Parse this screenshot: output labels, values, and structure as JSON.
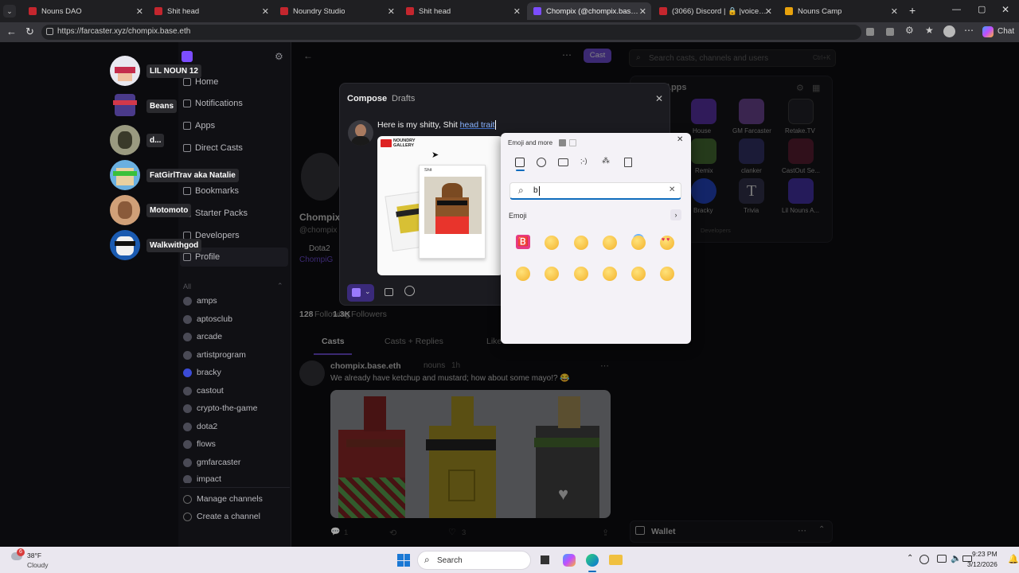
{
  "browser": {
    "tabs": [
      {
        "title": "Nouns DAO",
        "fav": "#c4262e"
      },
      {
        "title": "Shit head",
        "fav": "#c4262e"
      },
      {
        "title": "Noundry Studio",
        "fav": "#c4262e"
      },
      {
        "title": "Shit head",
        "fav": "#c4262e"
      },
      {
        "title": "Chompix (@chompix.base.eth) on",
        "fav": "#7c4dff",
        "active": true
      },
      {
        "title": "(3066) Discord | 🔒 |voice-public",
        "fav": "#c4262e"
      },
      {
        "title": "Nouns Camp",
        "fav": "#e8a20c"
      }
    ],
    "url": "https://farcaster.xyz/chompix.base.eth",
    "chat_label": "Chat"
  },
  "overlay_users": [
    "LIL NOUN 12",
    "Beans",
    "d...",
    "FatGirlTrav aka Natalie",
    "Motomoto",
    "Walkwithgod"
  ],
  "nav": {
    "items": [
      "Home",
      "Notifications",
      "Apps",
      "Direct Casts",
      "Bookmarks",
      "Starter Packs",
      "Developers",
      "Profile"
    ],
    "section_label": "All",
    "channels": [
      "amps",
      "aptosclub",
      "arcade",
      "artistprogram",
      "bracky",
      "castout",
      "crypto-the-game",
      "dota2",
      "flows",
      "gmfarcaster",
      "impact"
    ],
    "manage": "Manage channels",
    "create": "Create a channel"
  },
  "header": {
    "cast_button": "Cast",
    "search_placeholder": "Search casts, channels and users",
    "search_shortcut": "Ctrl+K"
  },
  "profile": {
    "name": "Chompix",
    "handle": "@chompix",
    "bio": "Dota2",
    "link": "ChompiG",
    "following_count": "128",
    "following_label": "Following",
    "followers_count": "1.3K",
    "followers_label": "Followers",
    "tabs": [
      "Casts",
      "Casts + Replies",
      "Likes"
    ]
  },
  "cast": {
    "author": "chompix.base.eth",
    "channel": "nouns",
    "time": "1h",
    "text": "We already have ketchup and mustard; how about some mayo!? 😂",
    "reply_count": "1",
    "like_count": "3"
  },
  "apps": {
    "title": "Apps",
    "items": [
      "House",
      "GM Farcaster",
      "Retake.TV",
      "Remix",
      "clanker",
      "CastOut Se...",
      "Bracky",
      "Trivia",
      "Lil Nouns A..."
    ],
    "footer": "Developers"
  },
  "wallet": "Wallet",
  "compose": {
    "tabs": [
      "Compose",
      "Drafts"
    ],
    "text": "Here is my shitty, Shit ",
    "highlight": "head  trait",
    "image_brand": "NOUNDRY GALLERY",
    "image_caption": "Shit"
  },
  "emoji_panel": {
    "title": "Emoji and more",
    "search_value": "b",
    "section": "Emoji",
    "emojis": [
      "🅱️",
      "😀",
      "😁",
      "😊",
      "😇",
      "😍",
      "😘",
      "😚",
      "😝",
      "🙂",
      "😯",
      "😉"
    ]
  },
  "taskbar": {
    "weather_temp": "38°F",
    "weather_desc": "Cloudy",
    "weather_badge": "6",
    "search": "Search",
    "time": "9:23 PM",
    "date": "3/12/2026"
  }
}
